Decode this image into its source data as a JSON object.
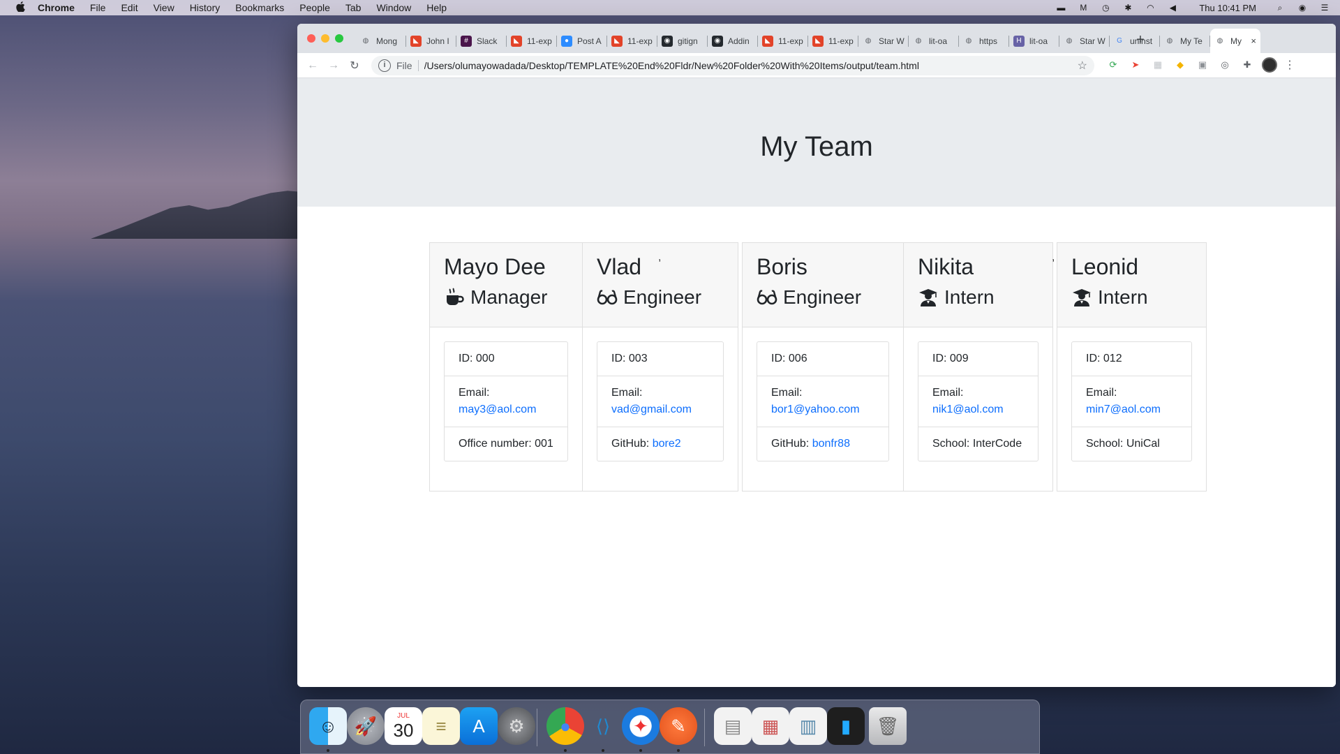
{
  "menubar": {
    "app": "Chrome",
    "items": [
      "File",
      "Edit",
      "View",
      "History",
      "Bookmarks",
      "People",
      "Tab",
      "Window",
      "Help"
    ],
    "clock": "Thu 10:41 PM",
    "status_icons": [
      "notification-icon",
      "malwarebytes-icon",
      "time-machine-icon",
      "bluetooth-icon",
      "wifi-icon",
      "volume-icon",
      "spotlight-icon",
      "siri-icon",
      "control-center-icon"
    ]
  },
  "browser": {
    "tabs": [
      {
        "label": "Mong",
        "icon": "globe-icon",
        "color": "#5f6368"
      },
      {
        "label": "John I",
        "icon": "gitlab-icon",
        "color": "#e24329"
      },
      {
        "label": "Slack",
        "icon": "slack-icon",
        "color": "#4a154b"
      },
      {
        "label": "11-exp",
        "icon": "gitlab-icon",
        "color": "#e24329"
      },
      {
        "label": "Post A",
        "icon": "zoom-icon",
        "color": "#2d8cff"
      },
      {
        "label": "11-exp",
        "icon": "gitlab-icon",
        "color": "#e24329"
      },
      {
        "label": "gitign",
        "icon": "github-icon",
        "color": "#24292e"
      },
      {
        "label": "Addin",
        "icon": "github-icon",
        "color": "#24292e"
      },
      {
        "label": "11-exp",
        "icon": "gitlab-icon",
        "color": "#e24329"
      },
      {
        "label": "11-exp",
        "icon": "gitlab-icon",
        "color": "#e24329"
      },
      {
        "label": "Star W",
        "icon": "globe-icon",
        "color": "#5f6368"
      },
      {
        "label": "lit-oa",
        "icon": "globe-icon",
        "color": "#5f6368"
      },
      {
        "label": "https",
        "icon": "globe-icon",
        "color": "#5f6368"
      },
      {
        "label": "lit-oa",
        "icon": "heroku-icon",
        "color": "#6762a6"
      },
      {
        "label": "Star W",
        "icon": "globe-icon",
        "color": "#5f6368"
      },
      {
        "label": "uninst",
        "icon": "google-icon",
        "color": "#4285f4"
      },
      {
        "label": "My Te",
        "icon": "globe-icon",
        "color": "#5f6368"
      },
      {
        "label": "My",
        "icon": "globe-icon",
        "color": "#5f6368",
        "active": true
      }
    ],
    "new_tab": "+",
    "close_tab": "×",
    "scheme_label": "File",
    "url": "/Users/olumayowadada/Desktop/TEMPLATE%20End%20Fldr/New%20Folder%20With%20Items/output/team.html"
  },
  "page": {
    "title": "My Team",
    "members": [
      {
        "name": "Mayo Dee",
        "role": "Manager",
        "icon": "coffee-icon",
        "id": "ID: 000",
        "email_label": "Email:",
        "email": "may3@aol.com",
        "extra_label": "Office number:",
        "extra_value": "001",
        "extra_link": false
      },
      {
        "name": "Vlad",
        "role": "Engineer",
        "icon": "glasses-icon",
        "id": "ID: 003",
        "email_label": "Email:",
        "email": "vad@gmail.com",
        "extra_label": "GitHub:",
        "extra_value": "bore2",
        "extra_link": true
      },
      {
        "name": "Boris",
        "role": "Engineer",
        "icon": "glasses-icon",
        "id": "ID: 006",
        "email_label": "Email:",
        "email": "bor1@yahoo.com",
        "extra_label": "GitHub:",
        "extra_value": "bonfr88",
        "extra_link": true
      },
      {
        "name": "Nikita",
        "role": "Intern",
        "icon": "graduate-icon",
        "id": "ID: 009",
        "email_label": "Email:",
        "email": "nik1@aol.com",
        "extra_label": "School:",
        "extra_value": "InterCode",
        "extra_link": false
      },
      {
        "name": "Leonid",
        "role": "Intern",
        "icon": "graduate-icon",
        "id": "ID: 012",
        "email_label": "Email:",
        "email": "min7@aol.com",
        "extra_label": "School:",
        "extra_value": "UniCal",
        "extra_link": false
      }
    ],
    "stray_commas": [
      ",",
      ","
    ]
  },
  "dock": {
    "apps": [
      "finder-icon",
      "launchpad-icon",
      "calendar-icon",
      "notes-icon",
      "app-store-icon",
      "system-preferences-icon",
      "chrome-icon",
      "vscode-icon",
      "safari-icon",
      "postman-icon",
      "window-thumbnail-icon",
      "window-thumbnail-icon",
      "window-thumbnail-icon",
      "window-thumbnail-icon",
      "trash-icon"
    ],
    "calendar_month": "JUL",
    "calendar_day": "30"
  }
}
